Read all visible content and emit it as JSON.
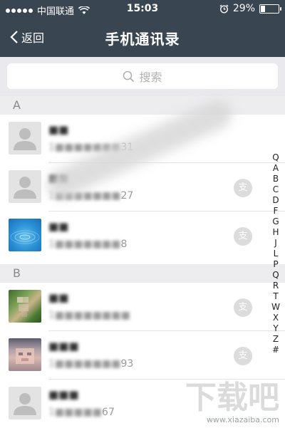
{
  "status_bar": {
    "carrier": "中国联通",
    "time": "15:03",
    "battery": "29%",
    "battery_level": 0.29
  },
  "nav": {
    "back_label": "返回",
    "title": "手机通讯录"
  },
  "search": {
    "placeholder": "搜索"
  },
  "sections": [
    {
      "letter": "A",
      "contacts": [
        {
          "name": "■■",
          "phone_blurred": "1■■■■■■■",
          "phone_visible": "31",
          "badge": null
        },
        {
          "name": "■■",
          "phone_blurred": "1■■■■■■■",
          "phone_visible": "27",
          "badge": "支"
        },
        {
          "name": "■■",
          "phone_blurred": "1■■■■■■■",
          "phone_visible": "8",
          "badge": "支"
        }
      ]
    },
    {
      "letter": "B",
      "contacts": [
        {
          "name": "■■",
          "phone_blurred": "1■■■■■■■■",
          "phone_visible": "",
          "badge": "支"
        },
        {
          "name": "■■■",
          "phone_blurred": "1■■■■■■■",
          "phone_visible": "93",
          "badge": "支"
        },
        {
          "name": "■■■",
          "phone_blurred": "1■■■■■",
          "phone_visible": "67",
          "badge": null
        }
      ]
    }
  ],
  "index_letters": [
    "Q",
    "A",
    "B",
    "C",
    "D",
    "F",
    "G",
    "H",
    "J",
    "L",
    "P",
    "Q",
    "R",
    "T",
    "W",
    "X",
    "Y",
    "Z",
    "#"
  ],
  "watermark": {
    "main": "下载吧",
    "sub": "www.xiazaiba.com"
  },
  "colors": {
    "bar": "#3a4552",
    "section_bg": "#ededf0",
    "search_bg": "#e9e9ee"
  }
}
